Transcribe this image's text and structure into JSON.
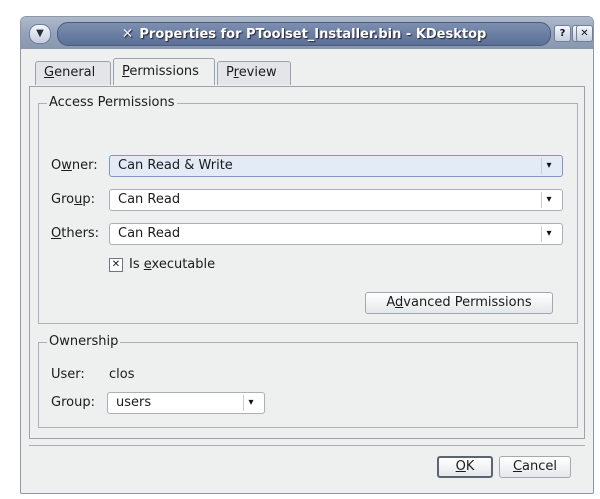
{
  "window": {
    "title": "Properties for PToolset_Installer.bin - KDesktop",
    "menu_icon": "chevron-down-icon",
    "app_icon": "x-app-icon",
    "help_label": "?",
    "maximize_label": "▲",
    "close_label": "✕"
  },
  "tabs": [
    {
      "pre": "",
      "ul": "G",
      "post": "eneral",
      "active": false
    },
    {
      "pre": "",
      "ul": "P",
      "post": "ermissions",
      "active": true
    },
    {
      "pre": "P",
      "ul": "r",
      "post": "eview",
      "active": false
    }
  ],
  "access": {
    "title": "Access Permissions",
    "owner": {
      "pre": "O",
      "ul": "w",
      "post": "ner:",
      "value": "Can Read & Write"
    },
    "group": {
      "pre": "Gro",
      "ul": "u",
      "post": "p:",
      "value": "Can Read"
    },
    "others": {
      "pre": "",
      "ul": "O",
      "post": "thers:",
      "value": "Can Read"
    },
    "executable": {
      "pre": "Is ",
      "ul": "e",
      "post": "xecutable",
      "checked": true,
      "mark": "✕"
    },
    "advanced": {
      "pre": "A",
      "ul": "d",
      "post": "vanced Permissions"
    }
  },
  "ownership": {
    "title": "Ownership",
    "user_label": "User:",
    "user_value": "clos",
    "group_label": "Group:",
    "group_value": "users"
  },
  "buttons": {
    "ok": {
      "pre": "",
      "ul": "O",
      "post": "K"
    },
    "cancel": {
      "pre": "",
      "ul": "C",
      "post": "ancel"
    }
  },
  "combo_arrow": "▾"
}
